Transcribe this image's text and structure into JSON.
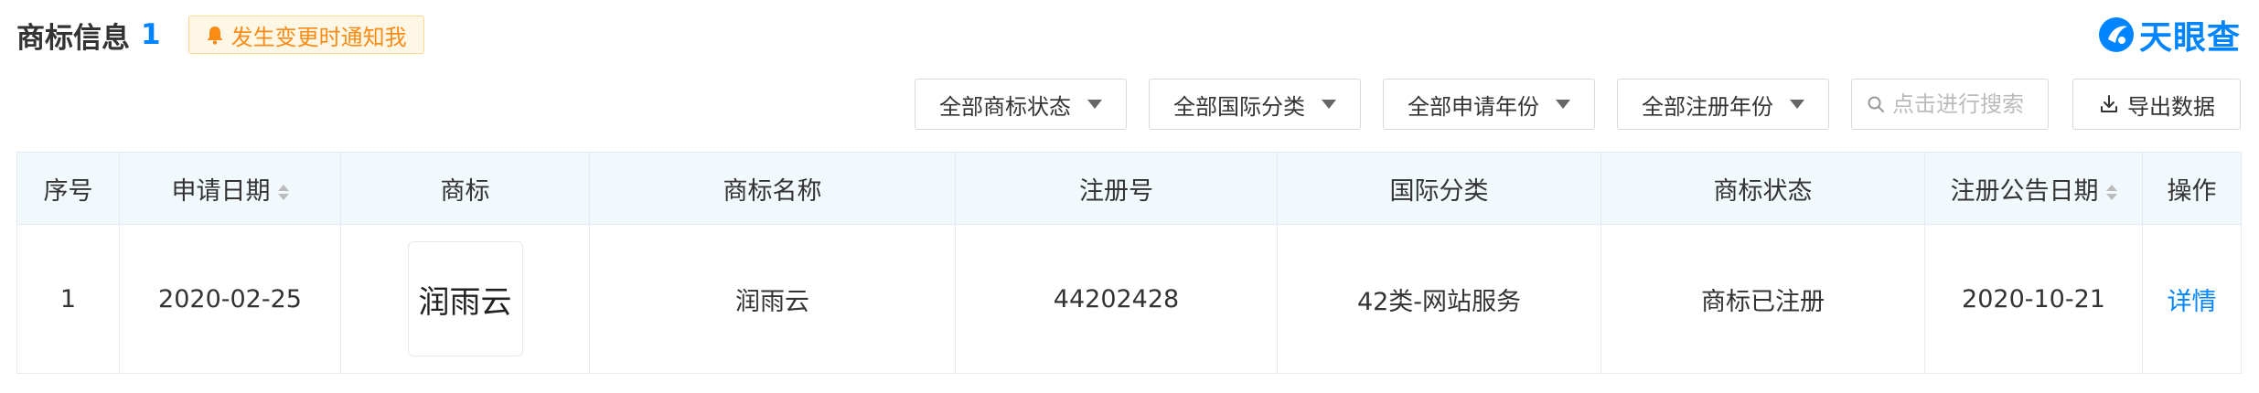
{
  "header": {
    "title": "商标信息",
    "count": "1",
    "notify_label": "发生变更时通知我",
    "brand_name": "天眼查"
  },
  "filters": {
    "status": "全部商标状态",
    "intl_class": "全部国际分类",
    "apply_year": "全部申请年份",
    "register_year": "全部注册年份",
    "search_placeholder": "点击进行搜索",
    "export_label": "导出数据"
  },
  "table": {
    "columns": [
      "序号",
      "申请日期",
      "商标",
      "商标名称",
      "注册号",
      "国际分类",
      "商标状态",
      "注册公告日期",
      "操作"
    ],
    "rows": [
      {
        "index": "1",
        "apply_date": "2020-02-25",
        "logo_text": "润雨云",
        "name": "润雨云",
        "reg_no": "44202428",
        "intl_class": "42类-网站服务",
        "status": "商标已注册",
        "announce_date": "2020-10-21",
        "action": "详情"
      }
    ]
  },
  "colors": {
    "accent": "#0084ff",
    "notify": "#fa8c16",
    "header_bg": "#f2f9fc"
  }
}
